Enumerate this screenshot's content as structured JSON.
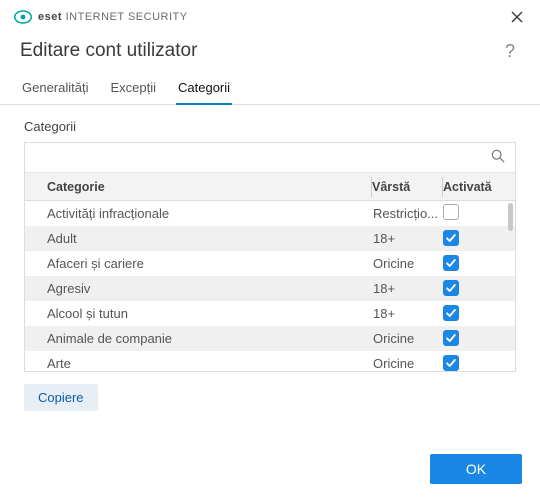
{
  "app": {
    "brand": "eset",
    "product": "INTERNET SECURITY"
  },
  "header": {
    "title": "Editare cont utilizator"
  },
  "tabs": [
    {
      "label": "Generalități",
      "active": false
    },
    {
      "label": "Excepții",
      "active": false
    },
    {
      "label": "Categorii",
      "active": true
    }
  ],
  "section": {
    "label": "Categorii"
  },
  "table": {
    "search_placeholder": "",
    "columns": {
      "category": "Categorie",
      "age": "Vârstă",
      "enabled": "Activată"
    },
    "rows": [
      {
        "category": "Activități infracționale",
        "age": "Restricțio...",
        "enabled": false
      },
      {
        "category": "Adult",
        "age": "18+",
        "enabled": true
      },
      {
        "category": "Afaceri și cariere",
        "age": "Oricine",
        "enabled": true
      },
      {
        "category": "Agresiv",
        "age": "18+",
        "enabled": true
      },
      {
        "category": "Alcool și tutun",
        "age": "18+",
        "enabled": true
      },
      {
        "category": "Animale de companie",
        "age": "Oricine",
        "enabled": true
      },
      {
        "category": "Arte",
        "age": "Oricine",
        "enabled": true
      }
    ]
  },
  "buttons": {
    "copy": "Copiere",
    "ok": "OK"
  }
}
